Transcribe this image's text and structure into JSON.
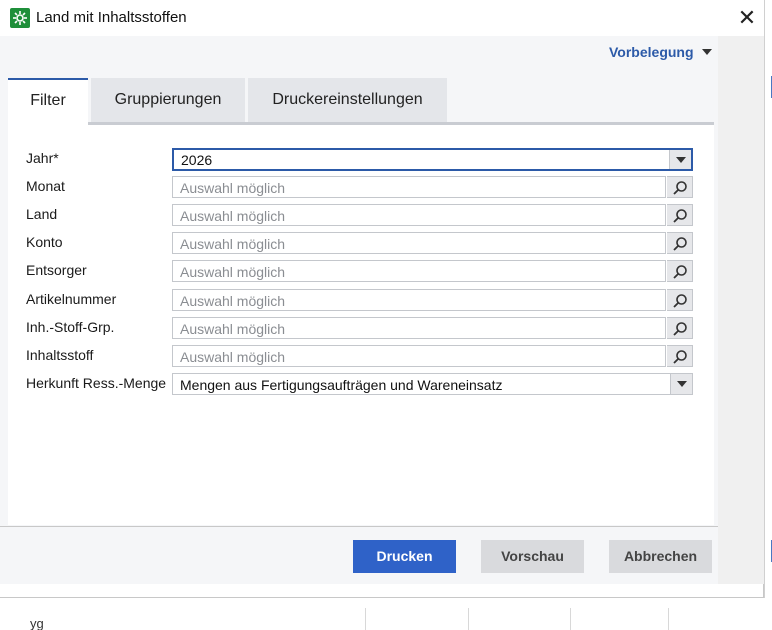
{
  "window": {
    "title": "Land mit Inhaltsstoffen",
    "close_label": "✕"
  },
  "header": {
    "preset_label": "Vorbelegung"
  },
  "tabs": [
    {
      "label": "Filter",
      "active": true
    },
    {
      "label": "Gruppierungen",
      "active": false
    },
    {
      "label": "Druckereinstellungen",
      "active": false
    }
  ],
  "form": {
    "year": {
      "label": "Jahr*",
      "value": "2026"
    },
    "month": {
      "label": "Monat",
      "placeholder": "Auswahl möglich"
    },
    "country": {
      "label": "Land",
      "placeholder": "Auswahl möglich"
    },
    "account": {
      "label": "Konto",
      "placeholder": "Auswahl möglich"
    },
    "disposer": {
      "label": "Entsorger",
      "placeholder": "Auswahl möglich"
    },
    "article": {
      "label": "Artikelnummer",
      "placeholder": "Auswahl möglich"
    },
    "substance_group": {
      "label": "Inh.-Stoff-Grp.",
      "placeholder": "Auswahl möglich"
    },
    "substance": {
      "label": "Inhaltsstoff",
      "placeholder": "Auswahl möglich"
    },
    "origin": {
      "label": "Herkunft Ress.-Menge",
      "value": "Mengen aus Fertigungsaufträgen und Wareneinsatz"
    }
  },
  "buttons": {
    "print": "Drucken",
    "preview": "Vorschau",
    "cancel": "Abbrechen"
  },
  "background": {
    "partial_glyph": "yg"
  },
  "colors": {
    "accent": "#2c5aa8",
    "primary_button": "#2f62c8",
    "app_icon": "#1f8f3a"
  },
  "icons": {
    "app": "app-gear-icon",
    "search": "search-icon",
    "dropdown": "chevron-down-icon",
    "close": "close-icon"
  }
}
